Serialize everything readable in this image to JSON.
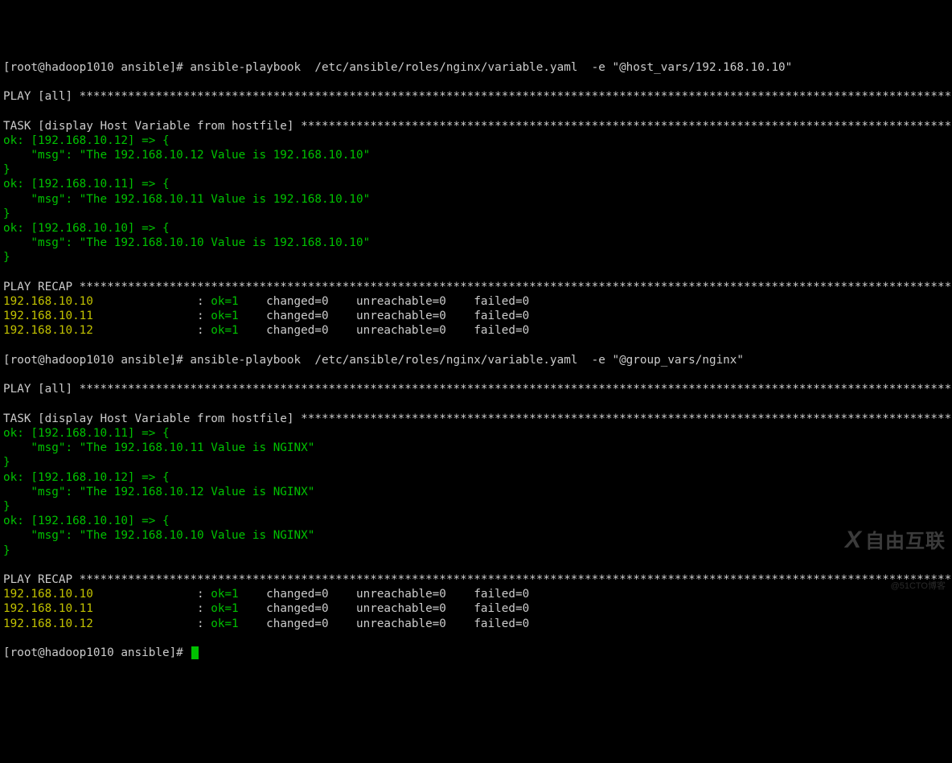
{
  "run1": {
    "prompt_user": "[root@hadoop1010 ansible]# ",
    "command": "ansible-playbook  /etc/ansible/roles/nginx/variable.yaml  -e \"@host_vars/192.168.10.10\"",
    "play_header": "PLAY [all] ",
    "task_header": "TASK [display Host Variable from hostfile] ",
    "results": [
      {
        "host": "192.168.10.12",
        "msg": "The 192.168.10.12 Value is 192.168.10.10"
      },
      {
        "host": "192.168.10.11",
        "msg": "The 192.168.10.11 Value is 192.168.10.10"
      },
      {
        "host": "192.168.10.10",
        "msg": "The 192.168.10.10 Value is 192.168.10.10"
      }
    ],
    "recap_header": "PLAY RECAP ",
    "recap": [
      {
        "host": "192.168.10.10",
        "ok": "ok=1",
        "rest": "    changed=0    unreachable=0    failed=0"
      },
      {
        "host": "192.168.10.11",
        "ok": "ok=1",
        "rest": "    changed=0    unreachable=0    failed=0"
      },
      {
        "host": "192.168.10.12",
        "ok": "ok=1",
        "rest": "    changed=0    unreachable=0    failed=0"
      }
    ]
  },
  "run2": {
    "prompt_user": "[root@hadoop1010 ansible]# ",
    "command": "ansible-playbook  /etc/ansible/roles/nginx/variable.yaml  -e \"@group_vars/nginx\"",
    "play_header": "PLAY [all] ",
    "task_header": "TASK [display Host Variable from hostfile] ",
    "results": [
      {
        "host": "192.168.10.11",
        "msg": "The 192.168.10.11 Value is NGINX"
      },
      {
        "host": "192.168.10.12",
        "msg": "The 192.168.10.12 Value is NGINX"
      },
      {
        "host": "192.168.10.10",
        "msg": "The 192.168.10.10 Value is NGINX"
      }
    ],
    "recap_header": "PLAY RECAP ",
    "recap": [
      {
        "host": "192.168.10.10",
        "ok": "ok=1",
        "rest": "    changed=0    unreachable=0    failed=0"
      },
      {
        "host": "192.168.10.11",
        "ok": "ok=1",
        "rest": "    changed=0    unreachable=0    failed=0"
      },
      {
        "host": "192.168.10.12",
        "ok": "ok=1",
        "rest": "    changed=0    unreachable=0    failed=0"
      }
    ]
  },
  "final_prompt": "[root@hadoop1010 ansible]# ",
  "ok_prefix": "ok: [",
  "ok_mid": "] => {",
  "msg_prefix": "    \"msg\": \"",
  "msg_suffix": "\"",
  "brace_close": "}",
  "recap_colon": "               : ",
  "watermark": {
    "brand": "自由互联",
    "sub": "@51CTO博客"
  }
}
